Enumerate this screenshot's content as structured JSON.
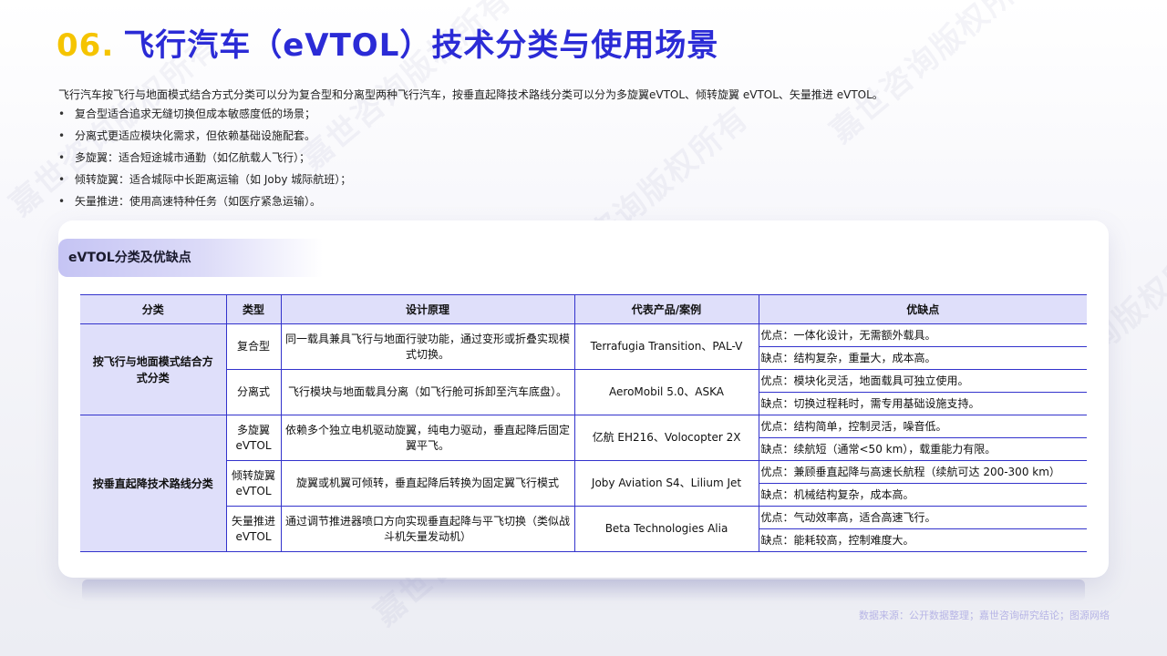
{
  "title": {
    "number": "06.",
    "text": "飞行汽车（eVTOL）技术分类与使用场景"
  },
  "intro": "飞行汽车按飞行与地面模式结合方式分类可以分为复合型和分离型两种飞行汽车，按垂直起降技术路线分类可以分为多旋翼eVTOL、倾转旋翼 eVTOL、矢量推进 eVTOL。",
  "bullets": [
    "复合型适合追求无缝切换但成本敏感度低的场景；",
    "分离式更适应模块化需求，但依赖基础设施配套。",
    "多旋翼：适合短途城市通勤（如亿航载人飞行）；",
    "倾转旋翼：适合城际中长距离运输（如 Joby 城际航班）；",
    "矢量推进：使用高速特种任务（如医疗紧急运输）。"
  ],
  "section_label": "eVTOL分类及优缺点",
  "table": {
    "headers": [
      "分类",
      "类型",
      "设计原理",
      "代表产品/案例",
      "优缺点"
    ],
    "groups": [
      {
        "category": "按飞行与地面模式结合方式分类",
        "rows": [
          {
            "type": "复合型",
            "principle": "同一载具兼具飞行与地面行驶功能，通过变形或折叠实现模式切换。",
            "product": "Terrafugia Transition、PAL-V",
            "pros": "优点：一体化设计，无需额外载具。",
            "cons": "缺点：结构复杂，重量大，成本高。"
          },
          {
            "type": "分离式",
            "principle": "飞行模块与地面载具分离（如飞行舱可拆卸至汽车底盘）。",
            "product": "AeroMobil 5.0、ASKA",
            "pros": "优点：模块化灵活，地面载具可独立使用。",
            "cons": "缺点：切换过程耗时，需专用基础设施支持。"
          }
        ]
      },
      {
        "category": "按垂直起降技术路线分类",
        "rows": [
          {
            "type": "多旋翼eVTOL",
            "principle": "依赖多个独立电机驱动旋翼，纯电力驱动，垂直起降后固定翼平飞。",
            "product": "亿航 EH216、Volocopter 2X",
            "pros": "优点：结构简单，控制灵活，噪音低。",
            "cons": "缺点：续航短（通常<50 km），载重能力有限。"
          },
          {
            "type": "倾转旋翼eVTOL",
            "principle": "旋翼或机翼可倾转，垂直起降后转换为固定翼飞行模式",
            "product": "Joby Aviation S4、Lilium Jet",
            "pros": "优点：兼顾垂直起降与高速长航程（续航可达 200-300 km）",
            "cons": "缺点：机械结构复杂，成本高。"
          },
          {
            "type": "矢量推进eVTOL",
            "principle": "通过调节推进器喷口方向实现垂直起降与平飞切换（类似战斗机矢量发动机）",
            "product": "Beta Technologies Alia",
            "pros": "优点：气动效率高，适合高速飞行。",
            "cons": "缺点：能耗较高，控制难度大。"
          }
        ]
      }
    ]
  },
  "source": "数据来源：公开数据整理；嘉世咨询研究结论；图源网络",
  "watermark": "嘉世咨询版权所有",
  "colors": {
    "title_number": "#f5c400",
    "title_text": "#2b2bd6",
    "table_header_bg": "#dfdffa",
    "table_border": "#3333cc",
    "source_text": "#b7b5e6"
  }
}
